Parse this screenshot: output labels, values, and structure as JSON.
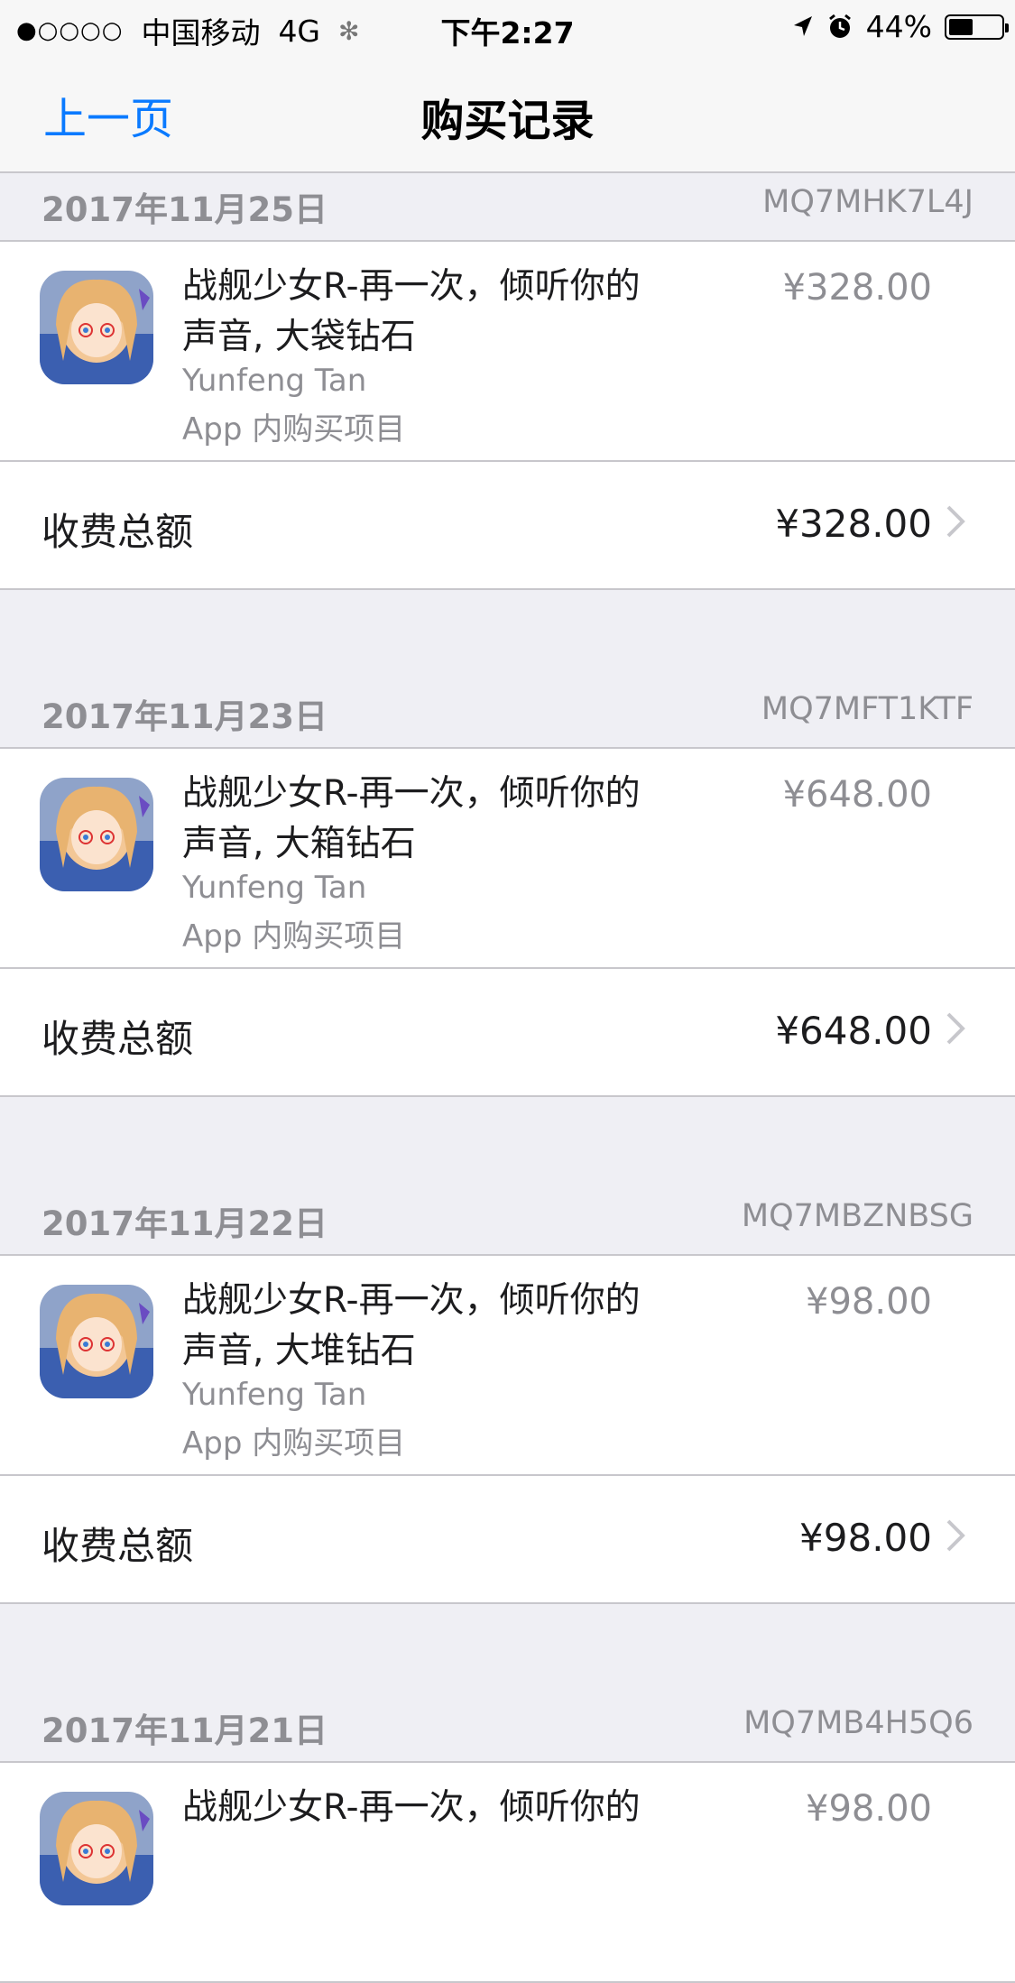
{
  "status": {
    "signal": "●○○○○",
    "carrier": "中国移动",
    "network": "4G",
    "time": "下午2:27",
    "battery": "44%",
    "battery_level": 0.44
  },
  "nav": {
    "back_label": "上一页",
    "title": "购买记录"
  },
  "total_label": "收费总额",
  "purchases": [
    {
      "date": "2017年11月25日",
      "order_id": "MQ7MHK7L4J",
      "title_line1": "战舰少女R-再一次，倾听你的",
      "title_line2": "声音, 大袋钻石",
      "developer": "Yunfeng Tan",
      "kind": "App 内购买项目",
      "price": "¥328.00",
      "total": "¥328.00"
    },
    {
      "date": "2017年11月23日",
      "order_id": "MQ7MFT1KTF",
      "title_line1": "战舰少女R-再一次，倾听你的",
      "title_line2": "声音, 大箱钻石",
      "developer": "Yunfeng Tan",
      "kind": "App 内购买项目",
      "price": "¥648.00",
      "total": "¥648.00"
    },
    {
      "date": "2017年11月22日",
      "order_id": "MQ7MBZNBSG",
      "title_line1": "战舰少女R-再一次，倾听你的",
      "title_line2": "声音, 大堆钻石",
      "developer": "Yunfeng Tan",
      "kind": "App 内购买项目",
      "price": "¥98.00",
      "total": "¥98.00"
    },
    {
      "date": "2017年11月21日",
      "order_id": "MQ7MB4H5Q6",
      "title_line1": "战舰少女R-再一次，倾听你的",
      "price": "¥98.00"
    }
  ]
}
